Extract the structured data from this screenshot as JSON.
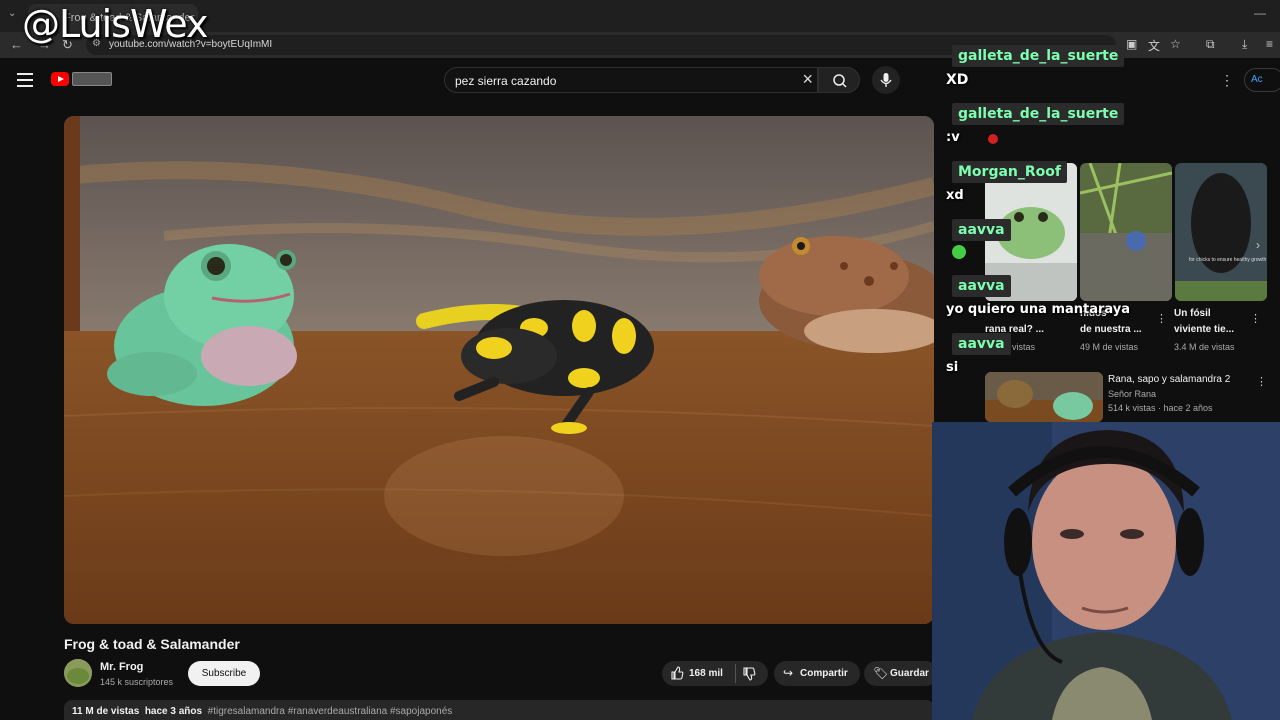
{
  "browser": {
    "tab_title": "Frog & toad & Salamander",
    "url": "youtube.com/watch?v=boytEUqImMI"
  },
  "overlay": {
    "watermark": "@LuisWex"
  },
  "header": {
    "search_value": "pez sierra cazando",
    "signin_label": "Ac"
  },
  "video": {
    "title": "Frog & toad & Salamander",
    "channel_name": "Mr. Frog",
    "subscribers": "145 k suscriptores",
    "subscribe_label": "Subscribe",
    "likes": "168 mil",
    "share_label": "Compartir",
    "save_label": "Guardar",
    "views": "11 M de vistas",
    "age": "hace 3 años",
    "hashtags": "#tigresalamandra #ranaverdeaustraliana #sapojaponés"
  },
  "recommendations": {
    "shorts": [
      {
        "title": "rana real? ...",
        "views": "vistas"
      },
      {
        "title": "de nuestra ...",
        "title_top": "nidos",
        "views": "49 M de vistas"
      },
      {
        "title": "viviente tie...",
        "title_top": "Un fósil",
        "views": "3.4 M de vistas",
        "thumb_caption": "for chicks to ensure healthy growth"
      }
    ],
    "video": {
      "title": "Rana, sapo y salamandra 2",
      "channel": "Señor Rana",
      "meta": "514 k vistas · hace 2 años"
    }
  },
  "chat": [
    {
      "user": "galleta_de_la_suerte",
      "message": "XD"
    },
    {
      "user": "galleta_de_la_suerte",
      "message": ":v"
    },
    {
      "user": "Morgan_Roof",
      "message": "xd"
    },
    {
      "user": "aavva",
      "message": ""
    },
    {
      "user": "aavva",
      "message": "yo quiero una mantaraya"
    },
    {
      "user": "aavva",
      "message": "si"
    }
  ],
  "colors": {
    "chat_username": "#7dffb0",
    "youtube_red": "#ff0000",
    "background": "#0f0f0f"
  }
}
